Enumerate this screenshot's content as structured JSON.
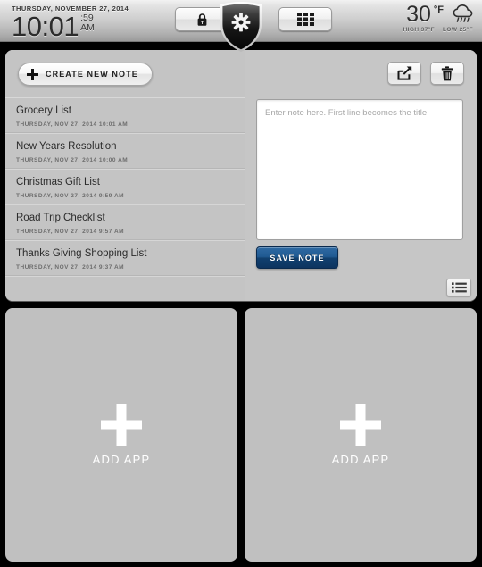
{
  "topbar": {
    "clock": {
      "date": "THURSDAY, NOVEMBER 27, 2014",
      "time": "10:01",
      "seconds": ":59",
      "ampm": "AM"
    },
    "buttons": {
      "lock": "lock-icon",
      "settings": "gear-shield-icon",
      "apps": "grid-icon"
    },
    "weather": {
      "temp": "30",
      "unit": "°F",
      "icon": "rain-cloud-icon",
      "high": "HIGH 37°F",
      "low": "LOW 25°F"
    }
  },
  "notes": {
    "create_label": "CREATE NEW NOTE",
    "items": [
      {
        "title": "Grocery List",
        "date": "THURSDAY, NOV 27, 2014 10:01 AM"
      },
      {
        "title": "New Years Resolution",
        "date": "THURSDAY, NOV 27, 2014 10:00 AM"
      },
      {
        "title": "Christmas Gift List",
        "date": "THURSDAY, NOV 27, 2014 9:59 AM"
      },
      {
        "title": "Road Trip Checklist",
        "date": "THURSDAY, NOV 27, 2014 9:57 AM"
      },
      {
        "title": "Thanks Giving Shopping List",
        "date": "THURSDAY, NOV 27, 2014 9:37 AM"
      }
    ],
    "editor": {
      "placeholder": "Enter note here. First line becomes the title.",
      "value": "",
      "share_icon": "share-icon",
      "delete_icon": "trash-icon",
      "save_label": "SAVE NOTE",
      "list_icon": "list-view-icon"
    }
  },
  "tiles": [
    {
      "label": "ADD APP",
      "icon": "plus-icon"
    },
    {
      "label": "ADD APP",
      "icon": "plus-icon"
    }
  ],
  "colors": {
    "background": "#000000",
    "panel": "#c6c6c6",
    "tile": "#c0c0c0",
    "save_button": "#205a92",
    "text_primary": "#2b2b2b",
    "text_muted": "#6d6d6d"
  }
}
